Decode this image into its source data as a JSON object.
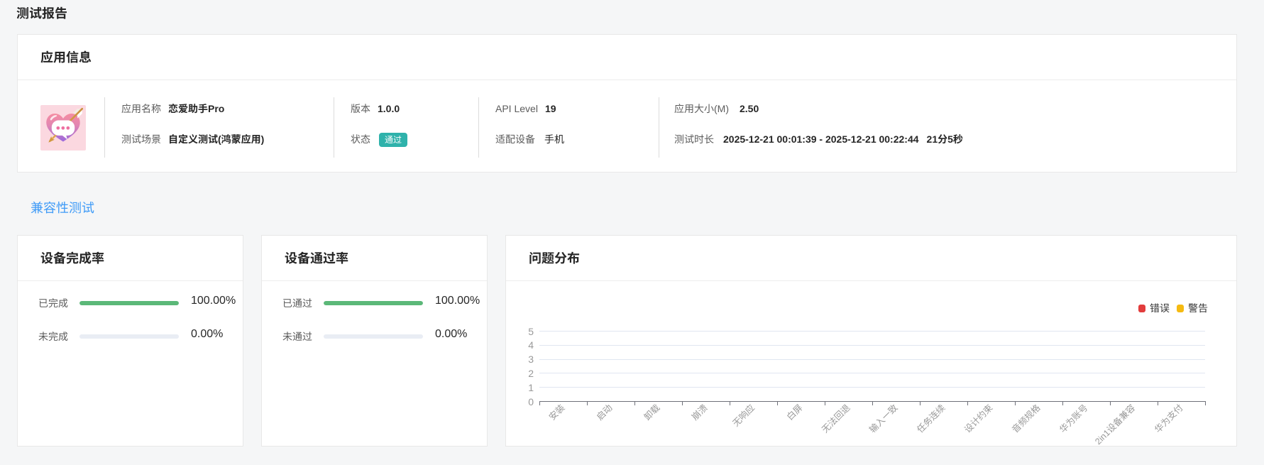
{
  "page": {
    "title": "测试报告",
    "background": "#f5f6f7"
  },
  "app_info": {
    "title": "应用信息",
    "icon": "heart-chat-arrow",
    "fields": [
      {
        "label": "应用名称",
        "value": "恋爱助手Pro"
      },
      {
        "label": "测试场景",
        "value": "自定义测试(鸿蒙应用)"
      },
      {
        "label": "版本",
        "value": "1.0.0"
      },
      {
        "label": "状态",
        "value": "通过",
        "type": "badge",
        "badge_color": "#2fb2ab"
      },
      {
        "label": "API Level",
        "value": "19"
      },
      {
        "label": "适配设备",
        "value": "手机"
      },
      {
        "label": "应用大小(M)",
        "value": "2.50"
      },
      {
        "label": "测试时长",
        "value": "2025-12-21 00:01:39 - 2025-12-21 00:22:44",
        "duration": "21分5秒"
      }
    ]
  },
  "section": {
    "title": "兼容性测试",
    "color": "#3f9bf7"
  },
  "completion_card": {
    "title": "设备完成率",
    "rows": [
      {
        "label": "已完成",
        "percent": "100.00%",
        "value": 100,
        "color": "#5bb878"
      },
      {
        "label": "未完成",
        "percent": "0.00%",
        "value": 0,
        "color": "#e9edf4"
      }
    ]
  },
  "pass_card": {
    "title": "设备通过率",
    "rows": [
      {
        "label": "已通过",
        "percent": "100.00%",
        "value": 100,
        "color": "#5bb878"
      },
      {
        "label": "未通过",
        "percent": "0.00%",
        "value": 0,
        "color": "#e9edf4"
      }
    ]
  },
  "chart_card": {
    "title": "问题分布"
  },
  "chart_data": {
    "type": "bar",
    "title": "问题分布",
    "categories": [
      "安装",
      "启动",
      "卸载",
      "崩溃",
      "无响应",
      "白屏",
      "无法回退",
      "输入一致",
      "任务连续",
      "设计约束",
      "音频规格",
      "华为账号",
      "2in1设备兼容",
      "华为支付"
    ],
    "series": [
      {
        "name": "错误",
        "color": "#e23c3c",
        "values": [
          0,
          0,
          0,
          0,
          0,
          0,
          0,
          0,
          0,
          0,
          0,
          0,
          0,
          0
        ]
      },
      {
        "name": "警告",
        "color": "#f5ba11",
        "values": [
          0,
          0,
          0,
          0,
          0,
          0,
          0,
          0,
          0,
          0,
          0,
          0,
          0,
          0
        ]
      }
    ],
    "xlabel": "",
    "ylabel": "",
    "ylim": [
      0,
      5
    ],
    "yticks": [
      0,
      1,
      2,
      3,
      4,
      5
    ],
    "legend_position": "top-right",
    "grid": true
  }
}
